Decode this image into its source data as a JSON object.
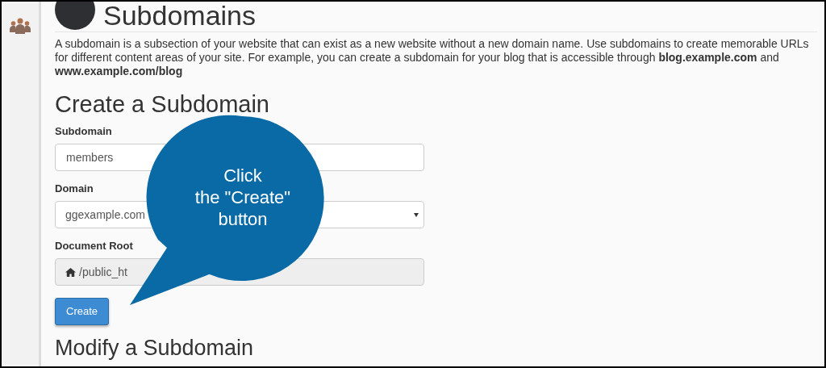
{
  "page_title": "Subdomains",
  "description": "A subdomain is a subsection of your website that can exist as a new website without a new domain name. Use subdomains to create memorable URLs for different content areas of your site. For example, you can create a subdomain for your blog that is accessible through **blog.example.com** and **www.example.com/blog**",
  "create_section": {
    "heading": "Create a Subdomain",
    "fields": [
      {
        "kind": "text",
        "label": "Subdomain",
        "value": "members"
      },
      {
        "kind": "select",
        "label": "Domain",
        "value": "ggexample.com"
      },
      {
        "kind": "readonly",
        "label": "Document Root",
        "value": "/public_ht"
      }
    ],
    "button": "Create"
  },
  "callout": {
    "lines": [
      "Click",
      "the \"Create\"",
      "button"
    ]
  },
  "modify_section": {
    "heading": "Modify a Subdomain"
  }
}
